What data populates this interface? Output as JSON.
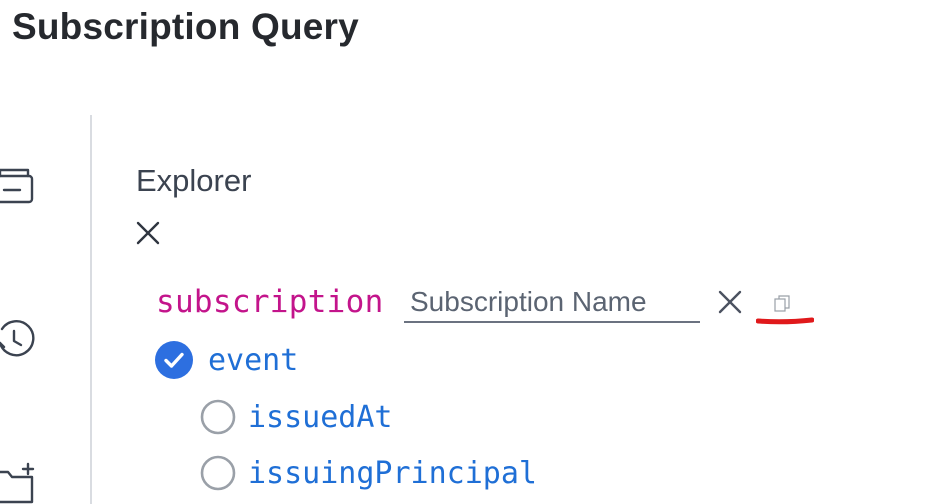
{
  "page": {
    "title": "Subscription Query"
  },
  "left_rail": {
    "icons": [
      "document-icon",
      "history-icon",
      "add-folder-icon"
    ]
  },
  "explorer": {
    "title": "Explorer",
    "close_icon": "close-icon"
  },
  "operation": {
    "keyword": "subscription",
    "name_placeholder": "Subscription Name",
    "name_value": "",
    "clear_icon": "close-icon",
    "copy_icon": "copy-icon"
  },
  "fields": {
    "root": {
      "label": "event",
      "checked": true
    },
    "children": [
      {
        "label": "issuedAt",
        "checked": false
      },
      {
        "label": "issuingPrincipal",
        "checked": false
      }
    ]
  },
  "colors": {
    "keyword": "#c3148b",
    "field": "#1f6fd6",
    "checked": "#2d6fe0",
    "annotation": "#e0191b"
  }
}
